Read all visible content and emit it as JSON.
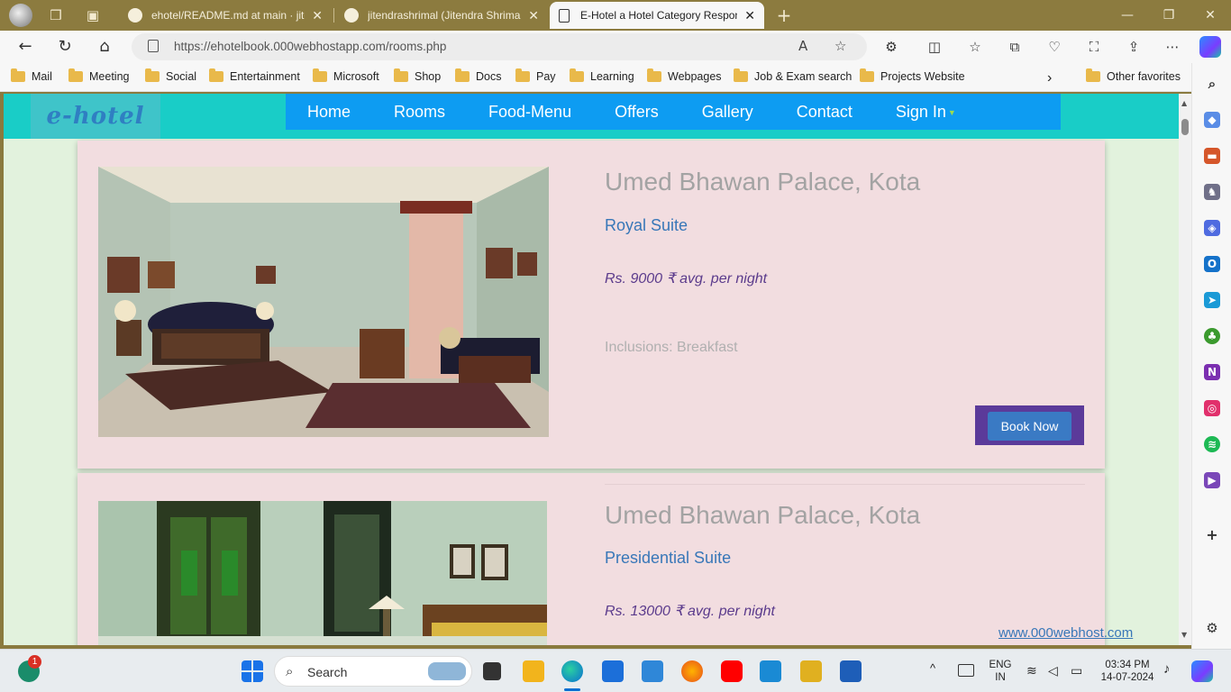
{
  "browser": {
    "tabs": [
      {
        "title": "ehotel/README.md at main · jite",
        "close": "✕"
      },
      {
        "title": "jitendrashrimal (Jitendra Shrimal)",
        "close": "✕"
      },
      {
        "title": "E-Hotel a Hotel Category Respon",
        "close": "✕"
      }
    ],
    "new_tab": "+",
    "window_controls": {
      "minimize": "—",
      "restore": "❐",
      "close": "✕"
    },
    "url": "https://ehotelbook.000webhostapp.com/rooms.php",
    "favorites": [
      "Mail",
      "Meeting",
      "Social",
      "Entertainment",
      "Microsoft",
      "Shop",
      "Docs",
      "Pay",
      "Learning",
      "Webpages",
      "Job & Exam search",
      "Projects Website"
    ],
    "favorites_more": "›",
    "other_favorites": "Other favorites"
  },
  "site": {
    "logo": "e-hotel",
    "menu": [
      "Home",
      "Rooms",
      "Food-Menu",
      "Offers",
      "Gallery",
      "Contact",
      "Sign In"
    ],
    "rooms": [
      {
        "name": "Umed Bhawan Palace, Kota",
        "type": "Royal Suite",
        "price": "Rs. 9000 ₹ avg. per night",
        "inclusions": "Inclusions: Breakfast",
        "book_label": "Book Now"
      },
      {
        "name": "Umed Bhawan Palace, Kota",
        "type": "Presidential Suite",
        "price": "Rs. 13000 ₹ avg. per night"
      }
    ],
    "host_badge": "www.000webhost.com"
  },
  "taskbar": {
    "search_placeholder": "Search",
    "notification_count": "1",
    "language": "ENG",
    "region": "IN",
    "time": "03:34 PM",
    "date": "14-07-2024"
  }
}
